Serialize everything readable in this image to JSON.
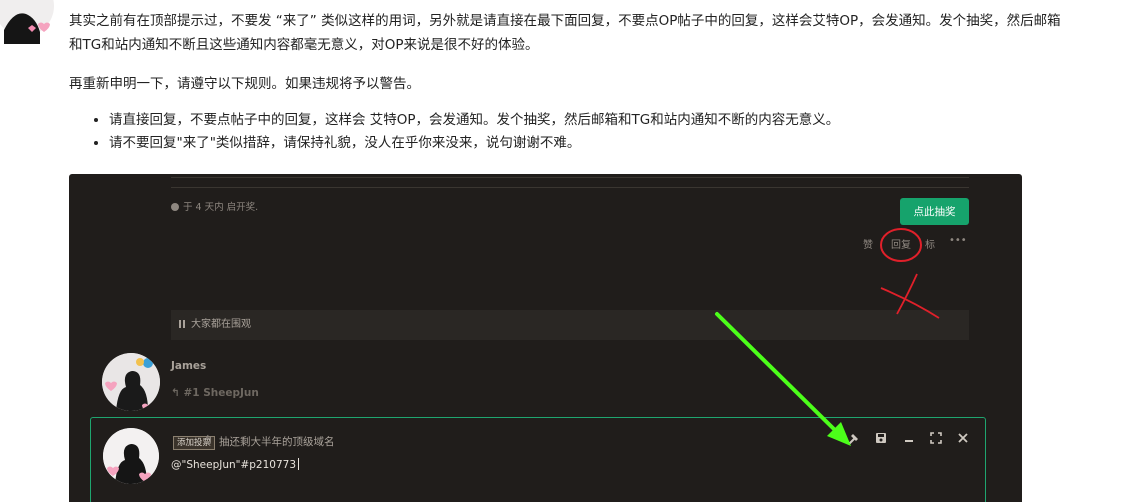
{
  "post": {
    "paragraph1": "其实之前有在顶部提示过，不要发 “来了” 类似这样的用词，另外就是请直接在最下面回复，不要点OP帖子中的回复，这样会艾特OP，会发通知。发个抽奖，然后邮箱和TG和站内通知不断且这些通知内容都毫无意义，对OP来说是很不好的体验。",
    "paragraph2": "再重新申明一下，请遵守以下规则。如果违规将予以警告。",
    "rules": [
      "请直接回复，不要点帖子中的回复，这样会 艾特OP，会发通知。发个抽奖，然后邮箱和TG和站内通知不断的内容无意义。",
      "请不要回复\"来了\"类似措辞，请保持礼貌，没人在乎你来没来，说句谢谢不难。"
    ]
  },
  "screenshot": {
    "opened_text": "于 4 天内 启开奖.",
    "lottery_button": "点此抽奖",
    "actions": {
      "like": "赞",
      "reply": "回复",
      "other": "标",
      "more": "•••"
    },
    "watching_text": "大家都在围观",
    "reply_user": "James",
    "reply_to": "#1 SheepJun",
    "composer": {
      "vote_badge": "添加投票",
      "topic_title": "抽还剩大半年的顶级域名",
      "editor_text": "@\"SheepJun\"#p210773"
    },
    "colors": {
      "background": "#201d1b",
      "accent_green": "#16a36c",
      "annotation_red": "#e0202a",
      "annotation_arrow": "#4cff1a"
    }
  }
}
